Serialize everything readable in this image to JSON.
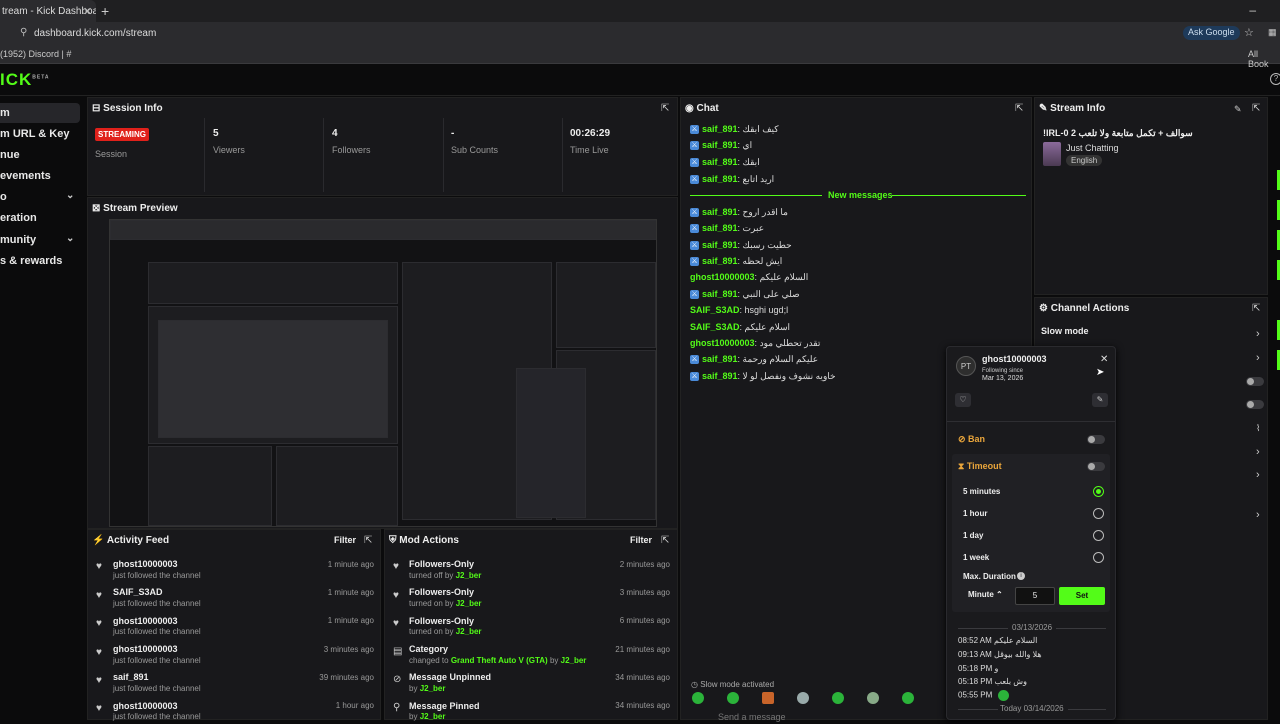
{
  "browser": {
    "tab_title": "tream - Kick Dashboard",
    "tab_close": "✕",
    "new_tab": "+",
    "window_controls": "–",
    "url": "dashboard.kick.com/stream",
    "ask_google": "Ask Google",
    "bookmark_left": "(1952) Discord | #",
    "bookmark_right": "All Book"
  },
  "brand": {
    "logo": "ICK",
    "logo_sup": "BETA",
    "accent": "#53fc18",
    "live_red": "#e0211b"
  },
  "sidebar": {
    "items": [
      {
        "label": "m",
        "active": true
      },
      {
        "label": "m URL & Key"
      },
      {
        "label": "nue"
      },
      {
        "label": "evements"
      },
      {
        "label": "o",
        "chevron": "⌄"
      },
      {
        "label": "eration"
      },
      {
        "label": "munity",
        "chevron": "⌄"
      },
      {
        "label": "s & rewards"
      }
    ]
  },
  "session": {
    "title": "Session Info",
    "badge": "STREAMING",
    "status_label": "Session",
    "stats": [
      {
        "value": "5",
        "label": "Viewers"
      },
      {
        "value": "4",
        "label": "Followers"
      },
      {
        "value": "-",
        "label": "Sub Counts"
      },
      {
        "value": "00:26:29",
        "label": "Time Live"
      }
    ]
  },
  "preview": {
    "title": "Stream Preview"
  },
  "chat": {
    "title": "Chat",
    "old_messages": [
      {
        "user": "saif_891",
        "text": "كيف ابقك"
      },
      {
        "user": "saif_891",
        "text": "اي"
      },
      {
        "user": "saif_891",
        "text": "ابقك"
      },
      {
        "user": "saif_891",
        "text": "اريد اتابع"
      }
    ],
    "divider": "New messages",
    "new_messages": [
      {
        "user": "saif_891",
        "text": "ما اقدر اروح",
        "badge": true
      },
      {
        "user": "saif_891",
        "text": "عبرت",
        "badge": true
      },
      {
        "user": "saif_891",
        "text": "حطيت رسبك",
        "badge": true
      },
      {
        "user": "saif_891",
        "text": "ايش لحظه",
        "badge": true
      },
      {
        "user": "ghost10000003",
        "text": "السلام عليكم",
        "badge": false
      },
      {
        "user": "saif_891",
        "text": "صلي على النبي",
        "badge": true
      },
      {
        "user": "SAIF_S3AD",
        "text": "hsghi ugd;l",
        "badge": false
      },
      {
        "user": "SAIF_S3AD",
        "text": "اسلام عليكم",
        "badge": false
      },
      {
        "user": "ghost10000003",
        "text": "تقدر تحطلي مود",
        "badge": false
      },
      {
        "user": "saif_891",
        "text": "عليكم السلام ورحمة",
        "badge": true
      },
      {
        "user": "saif_891",
        "text": "خاويه نشوف ونفصل لو لا",
        "badge": true
      }
    ],
    "slow_mode_notice": "Slow mode activated",
    "send_placeholder": "Send a message"
  },
  "stream_info": {
    "title": "Stream Info",
    "stream_title": "!IRL-0 سوالف + تكمل متابعة ولا تلعب 2",
    "category": "Just Chatting",
    "language": "English"
  },
  "channel_actions": {
    "title": "Channel Actions",
    "slow_mode": "Slow mode"
  },
  "activity": {
    "title": "Activity Feed",
    "filter": "Filter",
    "items": [
      {
        "name": "ghost10000003",
        "sub": "just followed the channel",
        "time": "1 minute ago"
      },
      {
        "name": "SAIF_S3AD",
        "sub": "just followed the channel",
        "time": "1 minute ago"
      },
      {
        "name": "ghost10000003",
        "sub": "just followed the channel",
        "time": "1 minute ago"
      },
      {
        "name": "ghost10000003",
        "sub": "just followed the channel",
        "time": "3 minutes ago"
      },
      {
        "name": "saif_891",
        "sub": "just followed the channel",
        "time": "39 minutes ago"
      },
      {
        "name": "ghost10000003",
        "sub": "just followed the channel",
        "time": "1 hour ago"
      }
    ]
  },
  "mod_actions": {
    "title": "Mod Actions",
    "filter": "Filter",
    "items": [
      {
        "name": "Followers-Only",
        "pre": "turned off by",
        "hl": "J2_ber",
        "post": "",
        "time": "2 minutes ago"
      },
      {
        "name": "Followers-Only",
        "pre": "turned on by",
        "hl": "J2_ber",
        "post": "",
        "time": "3 minutes ago"
      },
      {
        "name": "Followers-Only",
        "pre": "turned on by",
        "hl": "J2_ber",
        "post": "",
        "time": "6 minutes ago"
      },
      {
        "name": "Category",
        "pre": "changed to",
        "hl": "Grand Theft Auto V (GTA)",
        "post": "by",
        "hl2": "J2_ber",
        "time": "21 minutes ago"
      },
      {
        "name": "Message Unpinned",
        "pre": "by",
        "hl": "J2_ber",
        "post": "",
        "time": "34 minutes ago"
      },
      {
        "name": "Message Pinned",
        "pre": "by",
        "hl": "J2_ber",
        "post": "",
        "time": "34 minutes ago"
      }
    ]
  },
  "user_card": {
    "avatar": "PT",
    "username": "ghost10000003",
    "following_label": "Following since",
    "following_date": "Mar 13, 2026",
    "ban": "Ban",
    "timeout": "Timeout",
    "options": [
      {
        "label": "5 minutes",
        "selected": true
      },
      {
        "label": "1 hour",
        "selected": false
      },
      {
        "label": "1 day",
        "selected": false
      },
      {
        "label": "1 week",
        "selected": false
      }
    ],
    "max_duration": "Max. Duration",
    "unit": "Minute",
    "duration_value": "5",
    "set": "Set",
    "date1": "03/13/2026",
    "history": [
      {
        "time": "08:52 AM",
        "text": "السلام عليكم"
      },
      {
        "time": "09:13 AM",
        "text": "هلا والله بيوقل"
      },
      {
        "time": "05:18 PM",
        "text": "و"
      },
      {
        "time": "05:18 PM",
        "text": "وش بلعب"
      },
      {
        "time": "05:55 PM",
        "text": ""
      }
    ],
    "date2": "Today 03/14/2026"
  },
  "icons": {
    "popout": "⇱",
    "heart": "♥",
    "chevron_right": "›",
    "close": "✕",
    "pencil": "✎"
  }
}
